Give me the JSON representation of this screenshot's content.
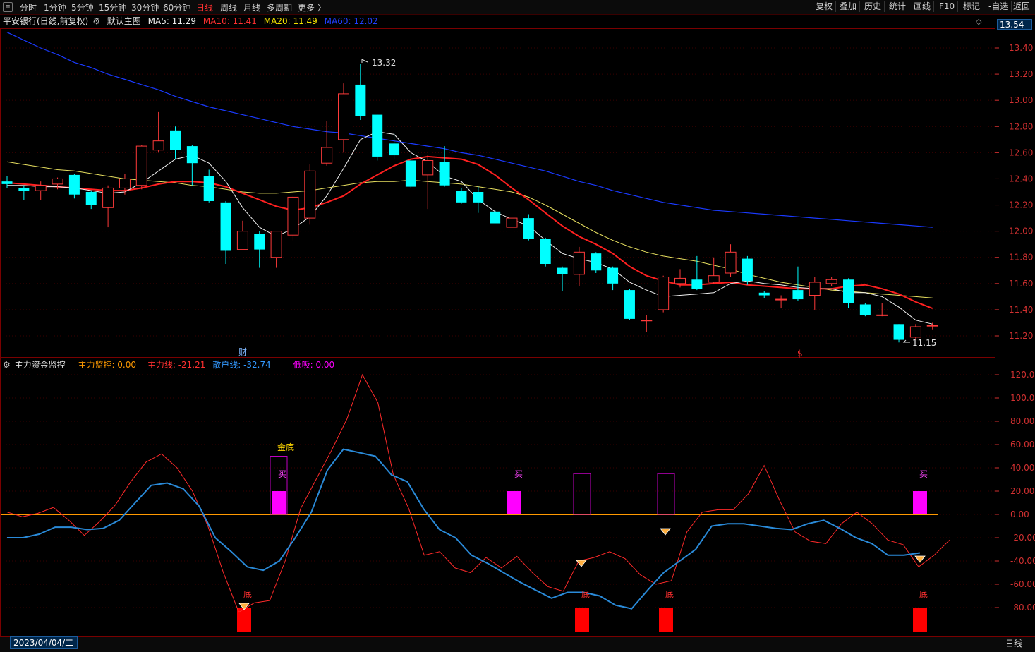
{
  "toolbar": {
    "periods": [
      "分时",
      "1分钟",
      "5分钟",
      "15分钟",
      "30分钟",
      "60分钟",
      "日线",
      "周线",
      "月线",
      "多周期",
      "更多 〉"
    ],
    "active_period": "日线",
    "right_buttons": [
      "复权",
      "叠加",
      "历史",
      "统计",
      "画线",
      "F10",
      "标记",
      "-自选",
      "返回"
    ]
  },
  "main_chart": {
    "title": "平安银行(日线,前复权)",
    "template": "默认主图",
    "ma_labels": [
      {
        "text": "MA5: 11.29",
        "color": "#f0f0f0"
      },
      {
        "text": "MA10: 11.41",
        "color": "#ff3030"
      },
      {
        "text": "MA20: 11.49",
        "color": "#f0e000"
      },
      {
        "text": "MA60: 12.02",
        "color": "#2040ff"
      }
    ],
    "current_price": "13.54",
    "high_label": "13.32",
    "low_label": "11.15",
    "marker_cai": "财",
    "marker_s": "$",
    "y_ticks": [
      "13.40",
      "13.20",
      "13.00",
      "12.80",
      "12.60",
      "12.40",
      "12.20",
      "12.00",
      "11.80",
      "11.60",
      "11.40",
      "11.20"
    ]
  },
  "indicator": {
    "title": "主力资金监控",
    "labels": [
      {
        "text": "主力监控: 0.00",
        "color": "#ff9900"
      },
      {
        "text": "主力线: -21.21",
        "color": "#ff3030"
      },
      {
        "text": "散户线: -32.74",
        "color": "#3399ff"
      },
      {
        "text": "低吸: 0.00",
        "color": "#ff00ff"
      }
    ],
    "y_ticks": [
      "120.00",
      "100.00",
      "80.00",
      "60.00",
      "40.00",
      "20.00",
      "0.00",
      "-20.00",
      "-40.00",
      "-60.00",
      "-80.00"
    ],
    "signal_gold": "金底",
    "signal_buy": "买",
    "signal_bottom": "底"
  },
  "chart_data": {
    "type": "candlestick",
    "candles": [
      {
        "o": 12.38,
        "c": 12.36,
        "h": 12.42,
        "l": 12.33
      },
      {
        "o": 12.33,
        "c": 12.31,
        "h": 12.35,
        "l": 12.24
      },
      {
        "o": 12.31,
        "c": 12.35,
        "h": 12.38,
        "l": 12.24
      },
      {
        "o": 12.36,
        "c": 12.4,
        "h": 12.41,
        "l": 12.32
      },
      {
        "o": 12.43,
        "c": 12.28,
        "h": 12.44,
        "l": 12.25
      },
      {
        "o": 12.3,
        "c": 12.2,
        "h": 12.31,
        "l": 12.17
      },
      {
        "o": 12.18,
        "c": 12.33,
        "h": 12.35,
        "l": 12.03
      },
      {
        "o": 12.33,
        "c": 12.4,
        "h": 12.44,
        "l": 12.28
      },
      {
        "o": 12.35,
        "c": 12.65,
        "h": 12.66,
        "l": 12.32
      },
      {
        "o": 12.62,
        "c": 12.69,
        "h": 12.91,
        "l": 12.6
      },
      {
        "o": 12.77,
        "c": 12.62,
        "h": 12.8,
        "l": 12.55
      },
      {
        "o": 12.65,
        "c": 12.52,
        "h": 12.66,
        "l": 12.35
      },
      {
        "o": 12.42,
        "c": 12.23,
        "h": 12.47,
        "l": 12.22
      },
      {
        "o": 12.22,
        "c": 11.85,
        "h": 12.23,
        "l": 11.75
      },
      {
        "o": 11.86,
        "c": 12.0,
        "h": 12.08,
        "l": 11.86
      },
      {
        "o": 11.98,
        "c": 11.86,
        "h": 12.0,
        "l": 11.72
      },
      {
        "o": 11.8,
        "c": 12.0,
        "h": 12.0,
        "l": 11.72
      },
      {
        "o": 11.97,
        "c": 12.26,
        "h": 12.27,
        "l": 11.93
      },
      {
        "o": 12.1,
        "c": 12.46,
        "h": 12.51,
        "l": 12.05
      },
      {
        "o": 12.52,
        "c": 12.64,
        "h": 12.84,
        "l": 12.5
      },
      {
        "o": 12.7,
        "c": 13.05,
        "h": 13.13,
        "l": 12.6
      },
      {
        "o": 13.12,
        "c": 12.88,
        "h": 13.28,
        "l": 12.85
      },
      {
        "o": 12.89,
        "c": 12.57,
        "h": 12.89,
        "l": 12.54
      },
      {
        "o": 12.67,
        "c": 12.58,
        "h": 12.75,
        "l": 12.55
      },
      {
        "o": 12.54,
        "c": 12.34,
        "h": 12.58,
        "l": 12.33
      },
      {
        "o": 12.43,
        "c": 12.54,
        "h": 12.58,
        "l": 12.17
      },
      {
        "o": 12.53,
        "c": 12.35,
        "h": 12.65,
        "l": 12.34
      },
      {
        "o": 12.31,
        "c": 12.22,
        "h": 12.33,
        "l": 12.21
      },
      {
        "o": 12.3,
        "c": 12.22,
        "h": 12.34,
        "l": 12.14
      },
      {
        "o": 12.15,
        "c": 12.06,
        "h": 12.16,
        "l": 12.06
      },
      {
        "o": 12.03,
        "c": 12.1,
        "h": 12.16,
        "l": 12.03
      },
      {
        "o": 12.1,
        "c": 11.94,
        "h": 12.13,
        "l": 11.93
      },
      {
        "o": 11.94,
        "c": 11.75,
        "h": 11.95,
        "l": 11.73
      },
      {
        "o": 11.72,
        "c": 11.67,
        "h": 11.73,
        "l": 11.54
      },
      {
        "o": 11.67,
        "c": 11.84,
        "h": 11.88,
        "l": 11.58
      },
      {
        "o": 11.83,
        "c": 11.7,
        "h": 11.84,
        "l": 11.68
      },
      {
        "o": 11.72,
        "c": 11.6,
        "h": 11.73,
        "l": 11.55
      },
      {
        "o": 11.55,
        "c": 11.33,
        "h": 11.56,
        "l": 11.32
      },
      {
        "o": 11.32,
        "c": 11.32,
        "h": 11.36,
        "l": 11.23
      },
      {
        "o": 11.4,
        "c": 11.65,
        "h": 11.66,
        "l": 11.38
      },
      {
        "o": 11.6,
        "c": 11.64,
        "h": 11.71,
        "l": 11.57
      },
      {
        "o": 11.63,
        "c": 11.56,
        "h": 11.81,
        "l": 11.55
      },
      {
        "o": 11.61,
        "c": 11.66,
        "h": 11.8,
        "l": 11.6
      },
      {
        "o": 11.68,
        "c": 11.84,
        "h": 11.9,
        "l": 11.65
      },
      {
        "o": 11.79,
        "c": 11.62,
        "h": 11.81,
        "l": 11.59
      },
      {
        "o": 11.53,
        "c": 11.51,
        "h": 11.54,
        "l": 11.49
      },
      {
        "o": 11.48,
        "c": 11.48,
        "h": 11.51,
        "l": 11.41
      },
      {
        "o": 11.55,
        "c": 11.48,
        "h": 11.73,
        "l": 11.47
      },
      {
        "o": 11.51,
        "c": 11.61,
        "h": 11.65,
        "l": 11.4
      },
      {
        "o": 11.6,
        "c": 11.63,
        "h": 11.65,
        "l": 11.58
      },
      {
        "o": 11.63,
        "c": 11.45,
        "h": 11.64,
        "l": 11.41
      },
      {
        "o": 11.44,
        "c": 11.36,
        "h": 11.45,
        "l": 11.35
      },
      {
        "o": 11.36,
        "c": 11.36,
        "h": 11.45,
        "l": 11.35
      },
      {
        "o": 11.29,
        "c": 11.17,
        "h": 11.29,
        "l": 11.15
      },
      {
        "o": 11.19,
        "c": 11.27,
        "h": 11.29,
        "l": 11.17
      },
      {
        "o": 11.28,
        "c": 11.28,
        "h": 11.3,
        "l": 11.25
      }
    ],
    "ma5": [
      12.35,
      12.35,
      12.34,
      12.34,
      12.33,
      12.31,
      12.29,
      12.3,
      12.37,
      12.46,
      12.55,
      12.58,
      12.52,
      12.38,
      12.18,
      12.03,
      11.96,
      12.02,
      12.11,
      12.27,
      12.48,
      12.7,
      12.76,
      12.74,
      12.6,
      12.53,
      12.42,
      12.38,
      12.24,
      12.15,
      12.09,
      12.04,
      11.93,
      11.83,
      11.79,
      11.76,
      11.71,
      11.61,
      11.55,
      11.5,
      11.51,
      11.52,
      11.53,
      11.6,
      11.62,
      11.6,
      11.59,
      11.57,
      11.56,
      11.56,
      11.53,
      11.53,
      11.5,
      11.42,
      11.32,
      11.29
    ],
    "ma10": [
      12.37,
      12.36,
      12.35,
      12.34,
      12.33,
      12.32,
      12.31,
      12.31,
      12.33,
      12.36,
      12.38,
      12.38,
      12.37,
      12.34,
      12.29,
      12.24,
      12.19,
      12.16,
      12.18,
      12.22,
      12.27,
      12.36,
      12.43,
      12.5,
      12.55,
      12.57,
      12.56,
      12.55,
      12.51,
      12.43,
      12.33,
      12.24,
      12.14,
      12.04,
      11.96,
      11.9,
      11.83,
      11.73,
      11.66,
      11.62,
      11.59,
      11.59,
      11.6,
      11.61,
      11.59,
      11.58,
      11.57,
      11.56,
      11.56,
      11.56,
      11.58,
      11.59,
      11.56,
      11.52,
      11.46,
      11.41
    ],
    "ma20": [
      12.53,
      12.51,
      12.49,
      12.47,
      12.46,
      12.44,
      12.42,
      12.4,
      12.39,
      12.38,
      12.37,
      12.35,
      12.34,
      12.32,
      12.3,
      12.29,
      12.29,
      12.3,
      12.31,
      12.33,
      12.35,
      12.37,
      12.38,
      12.38,
      12.39,
      12.38,
      12.37,
      12.36,
      12.34,
      12.32,
      12.3,
      12.26,
      12.2,
      12.13,
      12.06,
      11.99,
      11.93,
      11.88,
      11.84,
      11.81,
      11.79,
      11.77,
      11.74,
      11.71,
      11.67,
      11.64,
      11.61,
      11.59,
      11.57,
      11.55,
      11.54,
      11.53,
      11.52,
      11.51,
      11.5,
      11.49
    ],
    "ma60": [
      13.52,
      13.46,
      13.4,
      13.35,
      13.29,
      13.25,
      13.2,
      13.16,
      13.12,
      13.08,
      13.03,
      12.99,
      12.95,
      12.92,
      12.89,
      12.86,
      12.83,
      12.8,
      12.78,
      12.76,
      12.75,
      12.73,
      12.71,
      12.69,
      12.67,
      12.65,
      12.63,
      12.6,
      12.58,
      12.55,
      12.52,
      12.49,
      12.46,
      12.42,
      12.38,
      12.35,
      12.31,
      12.28,
      12.25,
      12.22,
      12.2,
      12.18,
      12.16,
      12.15,
      12.14,
      12.13,
      12.12,
      12.11,
      12.1,
      12.09,
      12.08,
      12.07,
      12.06,
      12.05,
      12.04,
      12.03
    ],
    "main_line": [
      2,
      -2,
      1,
      6,
      -5,
      -18,
      -6,
      8,
      28,
      45,
      52,
      40,
      20,
      -10,
      -50,
      -84,
      -76,
      -74,
      -40,
      5,
      30,
      55,
      82,
      120,
      96,
      34,
      5,
      -35,
      -32,
      -46,
      -50,
      -37,
      -46,
      -36,
      -50,
      -62,
      -66,
      -40,
      -37,
      -32,
      -38,
      -52,
      -60,
      -57,
      -15,
      2,
      4,
      4,
      18,
      42,
      12,
      -15,
      -23,
      -25,
      -8,
      2,
      -8,
      -22,
      -26,
      -45,
      -35,
      -22
    ],
    "retail_line": [
      -20,
      -20,
      -17,
      -11,
      -11,
      -13,
      -12,
      -5,
      10,
      25,
      27,
      22,
      7,
      -20,
      -32,
      -45,
      -48,
      -40,
      -20,
      2,
      38,
      56,
      53,
      50,
      34,
      28,
      5,
      -13,
      -20,
      -35,
      -42,
      -50,
      -58,
      -65,
      -72,
      -67,
      -67,
      -70,
      -78,
      -81,
      -65,
      -50,
      -40,
      -30,
      -10,
      -8,
      -8,
      -10,
      -12,
      -13,
      -8,
      -5,
      -12,
      -20,
      -25,
      -35,
      -35,
      -33
    ]
  }
}
